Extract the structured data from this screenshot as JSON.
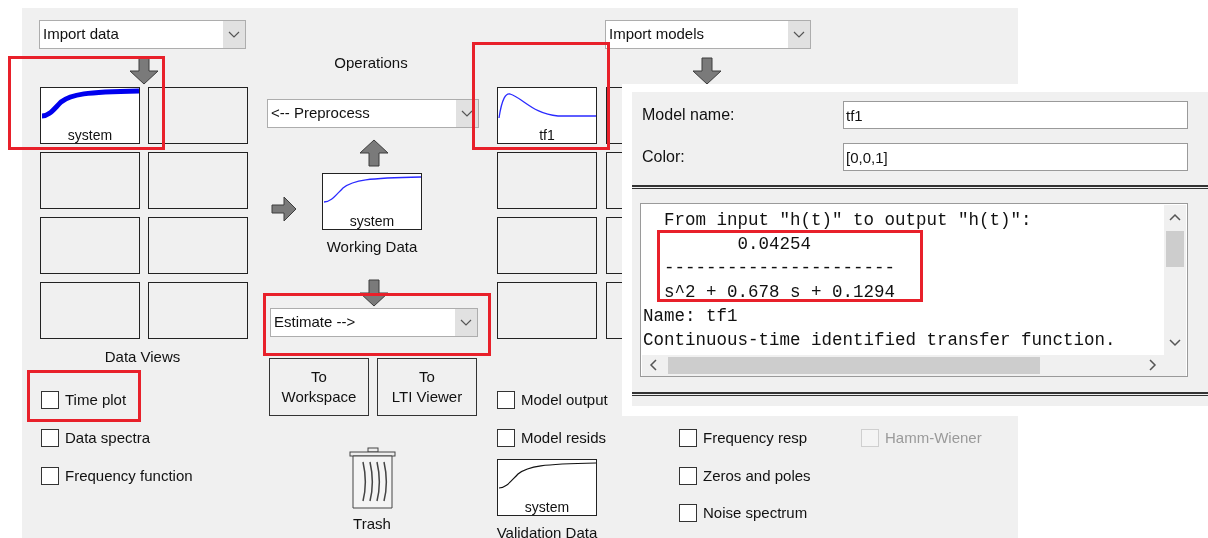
{
  "data_section": {
    "import_dropdown": "Import data",
    "tiles": [
      {
        "kind": "plot",
        "label": "system"
      },
      {
        "kind": "empty"
      },
      {
        "kind": "empty"
      },
      {
        "kind": "empty"
      },
      {
        "kind": "empty"
      },
      {
        "kind": "empty"
      },
      {
        "kind": "empty"
      },
      {
        "kind": "empty"
      }
    ],
    "title": "Data Views",
    "views": [
      {
        "label": "Time plot",
        "checked": false
      },
      {
        "label": "Data spectra",
        "checked": false
      },
      {
        "label": "Frequency function",
        "checked": false
      }
    ]
  },
  "operations": {
    "title": "Operations",
    "preprocess_dropdown": "<-- Preprocess",
    "working_data": {
      "label": "system",
      "caption": "Working Data"
    },
    "estimate_dropdown": "Estimate -->",
    "buttons": [
      {
        "lines": [
          "To",
          "Workspace"
        ]
      },
      {
        "lines": [
          "To",
          "LTI Viewer"
        ]
      }
    ],
    "trash": "Trash"
  },
  "model_section": {
    "import_dropdown": "Import models",
    "tiles": [
      {
        "kind": "plot",
        "label": "tf1"
      },
      {
        "kind": "empty"
      },
      {
        "kind": "empty"
      },
      {
        "kind": "empty"
      },
      {
        "kind": "empty"
      },
      {
        "kind": "empty"
      },
      {
        "kind": "empty"
      },
      {
        "kind": "empty"
      }
    ],
    "views": [
      {
        "label": "Model output",
        "checked": false,
        "disabled": false
      },
      {
        "label": "Model resids",
        "checked": false,
        "disabled": false
      },
      {
        "label": "Frequency resp",
        "checked": false,
        "disabled": false
      },
      {
        "label": "Zeros and poles",
        "checked": false,
        "disabled": false
      },
      {
        "label": "Noise spectrum",
        "checked": false,
        "disabled": false
      },
      {
        "label": "Hamm-Wiener",
        "checked": false,
        "disabled": true
      }
    ],
    "validation_data": {
      "label": "system",
      "caption": "Validation Data"
    }
  },
  "model_detail": {
    "fields": [
      {
        "label": "Model name:",
        "value": "tf1"
      },
      {
        "label": "Color:",
        "value": "[0,0,1]"
      }
    ],
    "text_lines": [
      "  From input \"h(t)\" to output \"h(t)\":",
      "         0.04254",
      "  ----------------------",
      "  s^2 + 0.678 s + 0.1294",
      "Name: tf1",
      "Continuous-time identified transfer function."
    ]
  }
}
